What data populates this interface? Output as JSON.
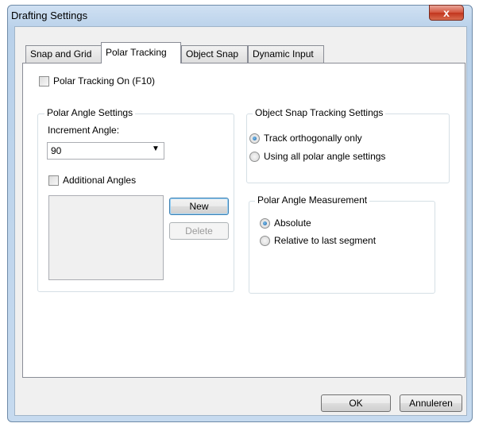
{
  "window": {
    "title": "Drafting Settings",
    "close_glyph": "x"
  },
  "tabs": [
    {
      "label": "Snap and Grid",
      "active": false
    },
    {
      "label": "Polar Tracking",
      "active": true
    },
    {
      "label": "Object Snap",
      "active": false
    },
    {
      "label": "Dynamic Input",
      "active": false
    }
  ],
  "polar_tracking_on": {
    "label": "Polar Tracking On (F10)",
    "checked": false
  },
  "polar_angle_settings": {
    "title": "Polar Angle Settings",
    "increment_label": "Increment Angle:",
    "increment_value": "90",
    "additional_angles": {
      "label": "Additional Angles",
      "checked": false
    },
    "new_button": "New",
    "delete_button": "Delete"
  },
  "object_snap_tracking": {
    "title": "Object Snap Tracking Settings",
    "options": [
      {
        "label": "Track orthogonally only",
        "selected": true
      },
      {
        "label": "Using all polar angle settings",
        "selected": false
      }
    ]
  },
  "polar_angle_measurement": {
    "title": "Polar Angle Measurement",
    "options": [
      {
        "label": "Absolute",
        "selected": true
      },
      {
        "label": "Relative to last segment",
        "selected": false
      }
    ]
  },
  "footer": {
    "ok_button": "OK",
    "cancel_button": "Annuleren"
  }
}
